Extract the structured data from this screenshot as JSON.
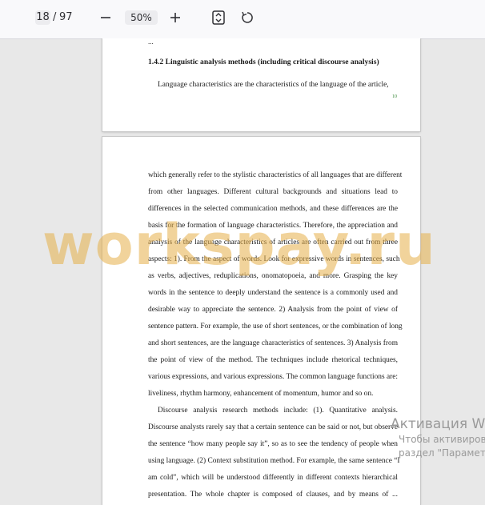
{
  "toolbar": {
    "page_current": "18",
    "page_separator": "/",
    "page_total": "97",
    "zoom": "50%",
    "icons": [
      "minus-icon",
      "plus-icon",
      "fit-page-icon",
      "rotate-icon"
    ]
  },
  "page1": {
    "top_fragment": "...",
    "heading": "1.4.2 Linguistic analysis methods (including critical discourse analysis)",
    "paragraph_line": "Language characteristics are the characteristics of the language of the article,",
    "page_number": "10"
  },
  "page2": {
    "lines": [
      "which generally refer to the stylistic characteristics of all languages that are different",
      "from other languages. Different cultural backgrounds and situations lead to",
      "differences in the selected communication methods, and these differences are the",
      "basis for the formation of language characteristics. Therefore, the appreciation and",
      "analysis of the language characteristics of articles are often carried out from three",
      "aspects: 1). From the aspect of words. Look for expressive words in sentences, such",
      "as verbs, adjectives, reduplications, onomatopoeia, and more. Grasping the key",
      "words in the sentence to deeply understand the sentence is a commonly used and",
      "desirable way to appreciate the sentence. 2) Analysis from the point of view of",
      "sentence pattern. For example, the use of short sentences, or the combination of long",
      "and short sentences, are the language characteristics of sentences. 3) Analysis from",
      "the point of view of the method. The techniques include rhetorical techniques,",
      "various expressions, and various expressions. The common language functions are:",
      "liveliness, rhythm harmony, enhancement of momentum, humor and so on.",
      "Discourse analysis research methods include: (1). Quantitative analysis.",
      "Discourse analysts rarely say that a certain sentence can be said or not, but observe",
      "the sentence “how many people say it”, so as to see the tendency of people when",
      "using language. (2) Context substitution method. For example, the same sentence “I",
      "am cold”, which will be understood differently in different contexts hierarchical",
      "presentation. The whole chapter is composed of clauses, and by means of ..."
    ]
  },
  "watermark": "workspay.ru",
  "activation": {
    "title": "Активация W",
    "line1": "Чтобы активиров",
    "line2": "раздел \"Парамет"
  }
}
